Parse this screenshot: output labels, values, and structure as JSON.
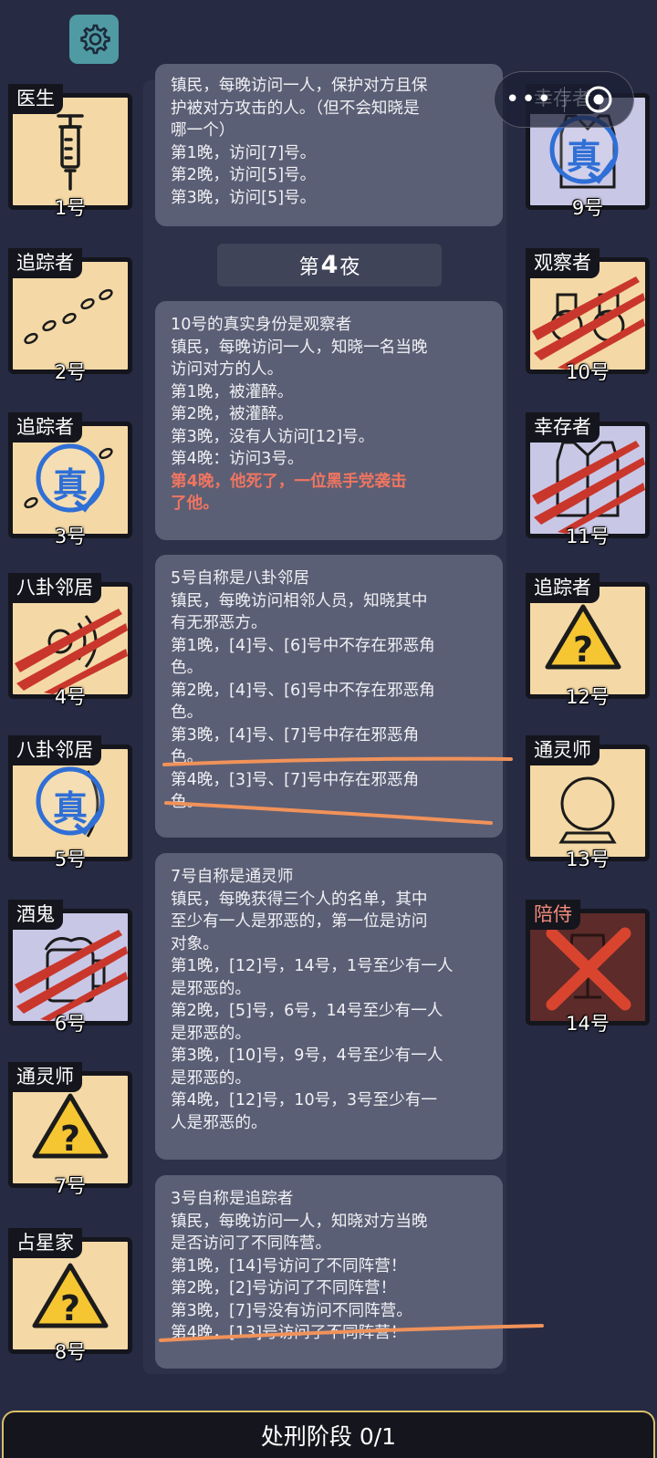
{
  "header": {
    "settings_icon": "gear-icon",
    "capsule_more": "•••",
    "capsule_close_icon": "target-circle-icon"
  },
  "left_players": [
    {
      "role": "医生",
      "number": "1号",
      "icon": "syringe-icon",
      "status": "alive"
    },
    {
      "role": "追踪者",
      "number": "2号",
      "icon": "footprints-icon",
      "status": "alive"
    },
    {
      "role": "追踪者",
      "number": "3号",
      "icon": "footprints-icon",
      "status": "alive",
      "stamp": "真"
    },
    {
      "role": "八卦邻居",
      "number": "4号",
      "icon": "speaker-icon",
      "status": "dead"
    },
    {
      "role": "八卦邻居",
      "number": "5号",
      "icon": "speaker-icon",
      "status": "alive",
      "stamp": "真"
    },
    {
      "role": "酒鬼",
      "number": "6号",
      "icon": "beer-mug-icon",
      "status": "dead"
    },
    {
      "role": "通灵师",
      "number": "7号",
      "icon": "warning-question-icon",
      "status": "alive"
    },
    {
      "role": "占星家",
      "number": "8号",
      "icon": "warning-question-icon",
      "status": "alive"
    }
  ],
  "right_players": [
    {
      "role": "幸存者",
      "number": "9号",
      "icon": "vest-icon",
      "status": "alive",
      "stamp": "真"
    },
    {
      "role": "观察者",
      "number": "10号",
      "icon": "binoculars-icon",
      "status": "dead"
    },
    {
      "role": "幸存者",
      "number": "11号",
      "icon": "vest-icon",
      "status": "dead"
    },
    {
      "role": "追踪者",
      "number": "12号",
      "icon": "warning-question-icon",
      "status": "alive"
    },
    {
      "role": "通灵师",
      "number": "13号",
      "icon": "crystal-ball-icon",
      "status": "alive"
    },
    {
      "role": "陪侍",
      "number": "14号",
      "icon": "wine-glass-icon",
      "status": "executed"
    }
  ],
  "stamp_text": "真",
  "night_banner": {
    "prefix": "第",
    "num": "4",
    "suffix": "夜"
  },
  "messages": {
    "doctor": [
      "镇民，每晚访问一人，保护对方且保",
      "护被对方攻击的人。（但不会知晓是",
      "哪一个）",
      "第1晚，访问[7]号。",
      "第2晚，访问[5]号。",
      "第3晚，访问[5]号。"
    ],
    "observer": [
      "10号的真实身份是观察者",
      "镇民，每晚访问一人，知晓一名当晚",
      "访问对方的人。",
      "第1晚，被灌醉。",
      "第2晚，被灌醉。",
      "第3晚，没有人访问[12]号。",
      "第4晚：访问3号。"
    ],
    "observer_death": [
      "第4晚，他死了，一位黑手党袭击",
      "了他。"
    ],
    "gossip": [
      "5号自称是八卦邻居",
      "镇民，每晚访问相邻人员，知晓其中",
      "有无邪恶方。",
      "第1晚，[4]号、[6]号中不存在邪恶角",
      "色。",
      "第2晚，[4]号、[6]号中不存在邪恶角",
      "色。",
      "第3晚，[4]号、[7]号中存在邪恶角",
      "色。",
      "第4晚，[3]号、[7]号中存在邪恶角",
      "色。"
    ],
    "medium": [
      "7号自称是通灵师",
      "镇民，每晚获得三个人的名单，其中",
      "至少有一人是邪恶的，第一位是访问",
      "对象。",
      "第1晚，[12]号，14号，1号至少有一人",
      "是邪恶的。",
      "第2晚，[5]号，6号，14号至少有一人",
      "是邪恶的。",
      "第3晚，[10]号，9号，4号至少有一人",
      "是邪恶的。",
      "第4晚，[12]号，10号，3号至少有一",
      "人是邪恶的。"
    ],
    "tracker": [
      "3号自称是追踪者",
      "镇民，每晚访问一人，知晓对方当晚",
      "是否访问了不同阵营。",
      "第1晚，[14]号访问了不同阵营！",
      "第2晚，[2]号访问了不同阵营！",
      "第3晚，[7]号没有访问不同阵营。",
      "第4晚，[13]号访问了不同阵营！"
    ]
  },
  "bottom_bar": {
    "label": "处刑阶段 0/1"
  },
  "colors": {
    "background": "#262a42",
    "message_bg": "#5b5f75",
    "death_text": "#f07560",
    "annotation_line": "#f0925a",
    "stamp_blue": "#2f6fd6",
    "claw_red": "#c9372c"
  }
}
